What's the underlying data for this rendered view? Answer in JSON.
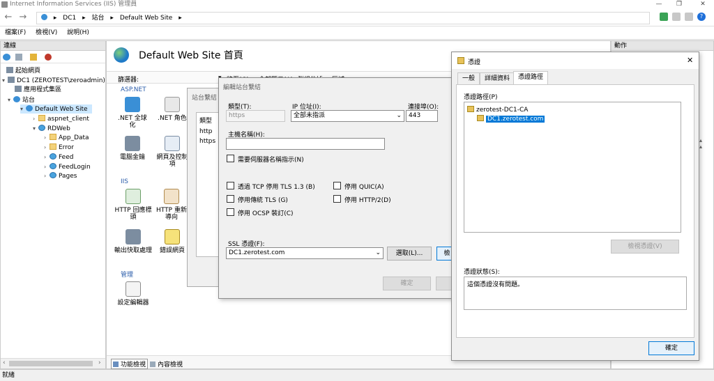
{
  "window": {
    "title": "Internet Information Services (IIS) 管理員"
  },
  "address": {
    "path": [
      "DC1",
      "站台",
      "Default Web Site"
    ]
  },
  "menu": [
    "檔案(F)",
    "檢視(V)",
    "說明(H)"
  ],
  "connections": {
    "title": "連線",
    "tree": [
      {
        "label": "起始網頁",
        "icon": "start-page-icon"
      },
      {
        "label": "DC1 (ZEROTEST\\zeroadmin)",
        "icon": "server-icon"
      },
      {
        "label": "應用程式集區",
        "icon": "app-pool-icon"
      },
      {
        "label": "站台",
        "icon": "sites-icon"
      },
      {
        "label": "Default Web Site",
        "icon": "globe-icon"
      },
      {
        "label": "aspnet_client",
        "icon": "folder-icon"
      },
      {
        "label": "RDWeb",
        "icon": "application-icon"
      },
      {
        "label": "App_Data",
        "icon": "folder-icon"
      },
      {
        "label": "Error",
        "icon": "folder-icon"
      },
      {
        "label": "Feed",
        "icon": "application-icon"
      },
      {
        "label": "FeedLogin",
        "icon": "application-icon"
      },
      {
        "label": "Pages",
        "icon": "application-icon"
      }
    ]
  },
  "home": {
    "title": "Default Web Site 首頁",
    "filter_label": "篩選器:",
    "toolbar": [
      "移至(G)",
      "全部顯示(A)",
      "群組依據:",
      "區域"
    ],
    "groups": {
      "aspnet": "ASP.NET",
      "iis": "IIS",
      "manage": "管理"
    },
    "features": {
      "net_global": ".NET 全球化",
      "net_role": ".NET 角色",
      "machine_key": "電腦金鑰",
      "pages_controls": "網頁及控制項",
      "http_response": "HTTP 回應標頭",
      "http_redirect": "HTTP 重新導向",
      "output_cache": "輸出快取處理",
      "error_pages": "錯誤網頁",
      "config_editor": "設定編輯器"
    },
    "view_tabs": [
      "功能檢視",
      "內容檢視"
    ]
  },
  "actions": {
    "title": "動作"
  },
  "site_bindings": {
    "title": "站台繫結",
    "col_type": "類型",
    "rows": [
      "http",
      "https"
    ]
  },
  "edit_binding": {
    "title": "編輯站台繫結",
    "type_label": "類型(T):",
    "type_value": "https",
    "ip_label": "IP 位址(I):",
    "ip_value": "全部未指派",
    "port_label": "連接埠(O):",
    "port_value": "443",
    "host_label": "主機名稱(H):",
    "host_value": "",
    "sni_label": "需要伺服器名稱指示(N)",
    "opt_tls13": "透過 TCP 停用 TLS 1.3 (B)",
    "opt_legacy_tls": "停用傳統 TLS (G)",
    "opt_ocsp": "停用 OCSP 裝訂(C)",
    "opt_quic": "停用 QUIC(A)",
    "opt_http2": "停用 HTTP/2(D)",
    "ssl_label": "SSL 憑證(F):",
    "ssl_value": "DC1.zerotest.com",
    "select_button": "選取(L)...",
    "view_button": "檢",
    "ok_button": "確定"
  },
  "certificate": {
    "title": "憑證",
    "tabs": [
      "一般",
      "詳細資料",
      "憑證路徑"
    ],
    "path_label": "憑證路徑(P)",
    "root": "zerotest-DC1-CA",
    "leaf": "DC1.zerotest.com",
    "view_cert_button": "檢視憑證(V)",
    "status_label": "憑證狀態(S):",
    "status_text": "這個憑證沒有問題。",
    "ok_button": "確定"
  },
  "statusbar": {
    "text": "就緒"
  }
}
